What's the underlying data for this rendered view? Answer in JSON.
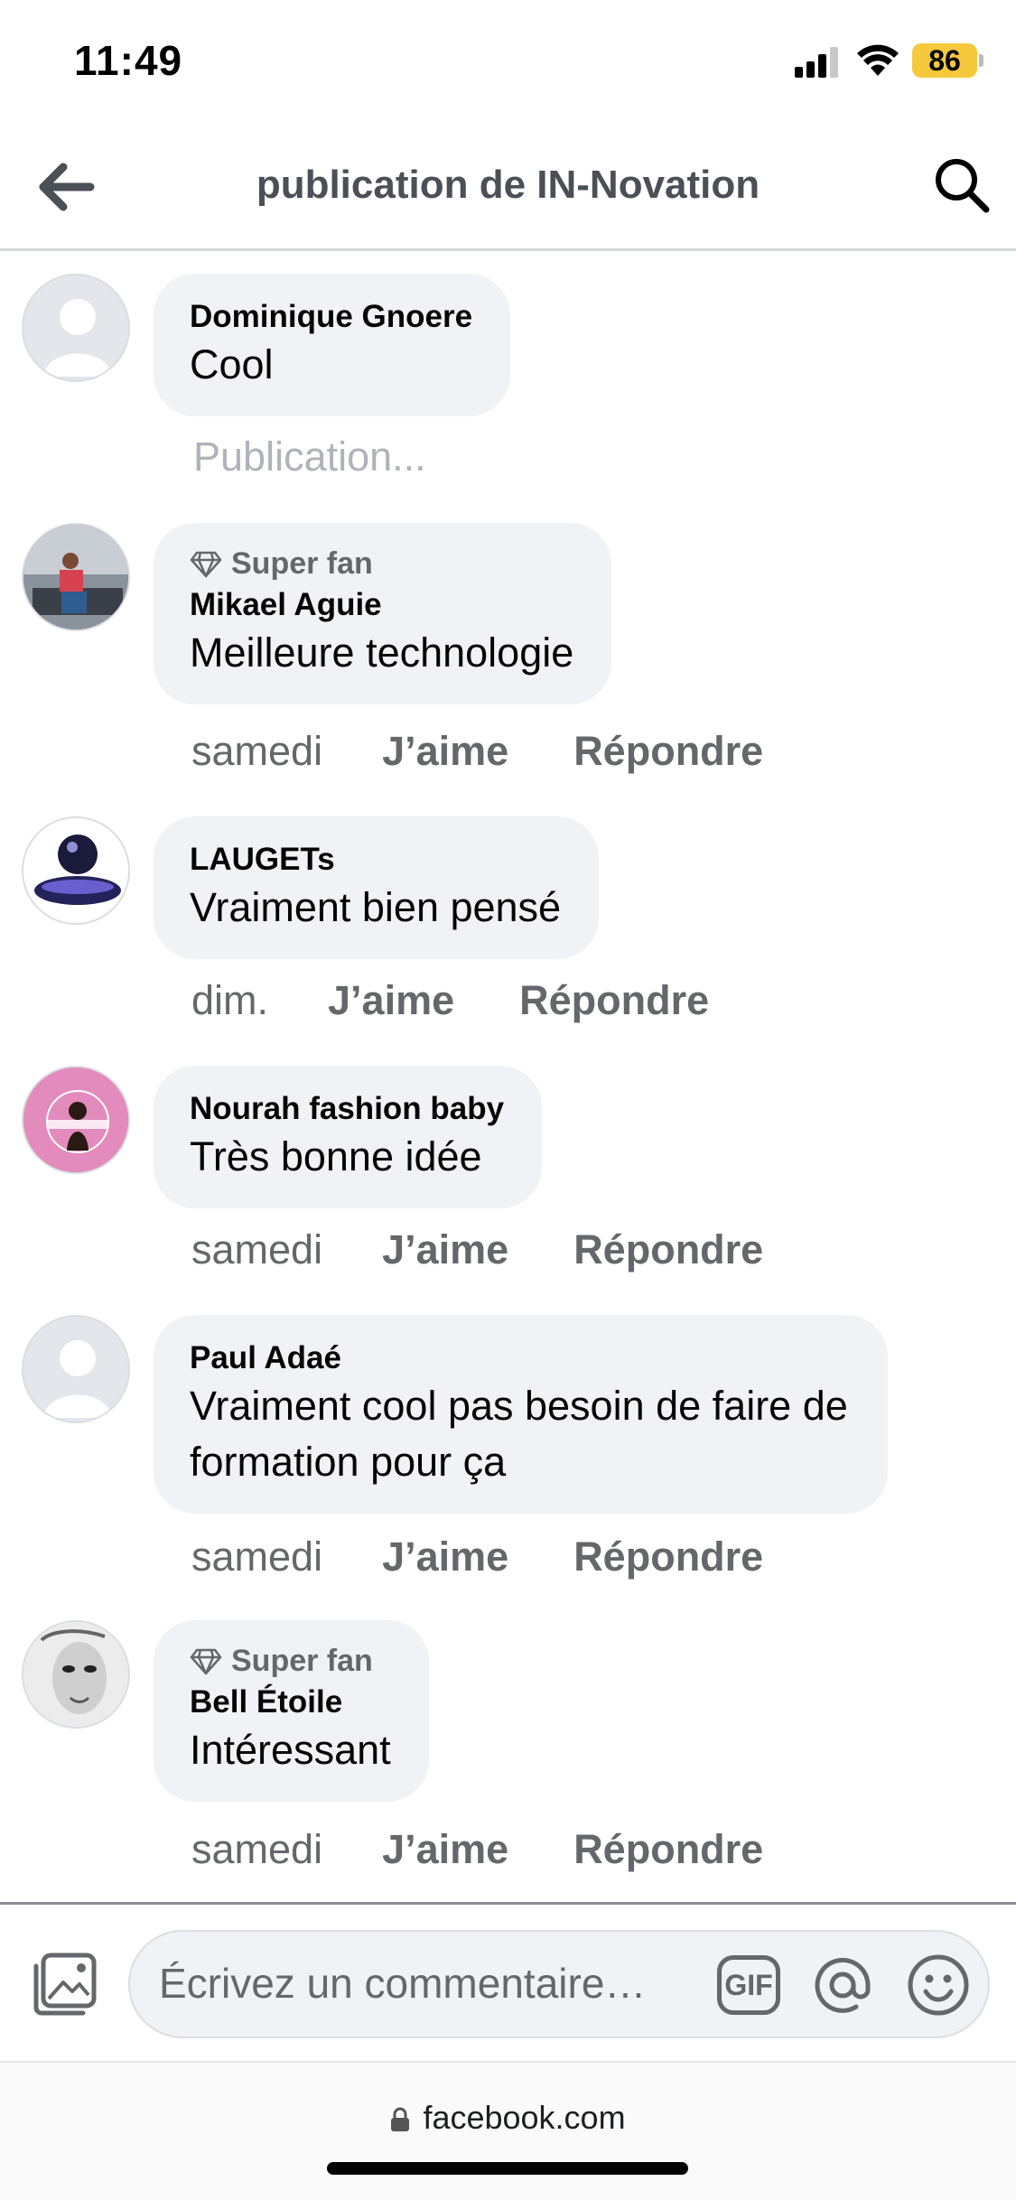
{
  "status_bar": {
    "time": "11:49",
    "battery": "86"
  },
  "header": {
    "title": "publication de IN-Novation"
  },
  "comments": [
    {
      "author": "Dominique Gnoere",
      "text": "Cool",
      "pending": "Publication..."
    },
    {
      "badge": "Super fan",
      "author": "Mikael Aguie",
      "text": "Meilleure technologie",
      "time": "samedi",
      "like": "J’aime",
      "reply": "Répondre"
    },
    {
      "author": "LAUGETs",
      "text": "Vraiment bien pensé",
      "time": "dim.",
      "like": "J’aime",
      "reply": "Répondre"
    },
    {
      "author": "Nourah fashion baby",
      "text": "Très bonne idée",
      "time": "samedi",
      "like": "J’aime",
      "reply": "Répondre"
    },
    {
      "author": "Paul Adaé",
      "text_line1": "Vraiment cool pas besoin de faire de",
      "text_line2": "formation pour ça",
      "time": "samedi",
      "like": "J’aime",
      "reply": "Répondre"
    },
    {
      "badge": "Super fan",
      "author": "Bell Étoile",
      "text": "Intéressant",
      "time": "samedi",
      "like": "J’aime",
      "reply": "Répondre"
    }
  ],
  "composer": {
    "placeholder": "Écrivez un commentaire…",
    "gif_label": "GIF"
  },
  "browser": {
    "url": "facebook.com"
  },
  "icons": {
    "back": "arrow-left-icon",
    "search": "search-icon",
    "photo": "photo-icon",
    "mention": "at-icon",
    "emoji": "smiley-icon",
    "lock": "lock-icon",
    "badge": "diamond-icon"
  },
  "colors": {
    "bubble": "#f0f2f5",
    "secondary_text": "#65676b",
    "battery": "#f6c93c"
  }
}
